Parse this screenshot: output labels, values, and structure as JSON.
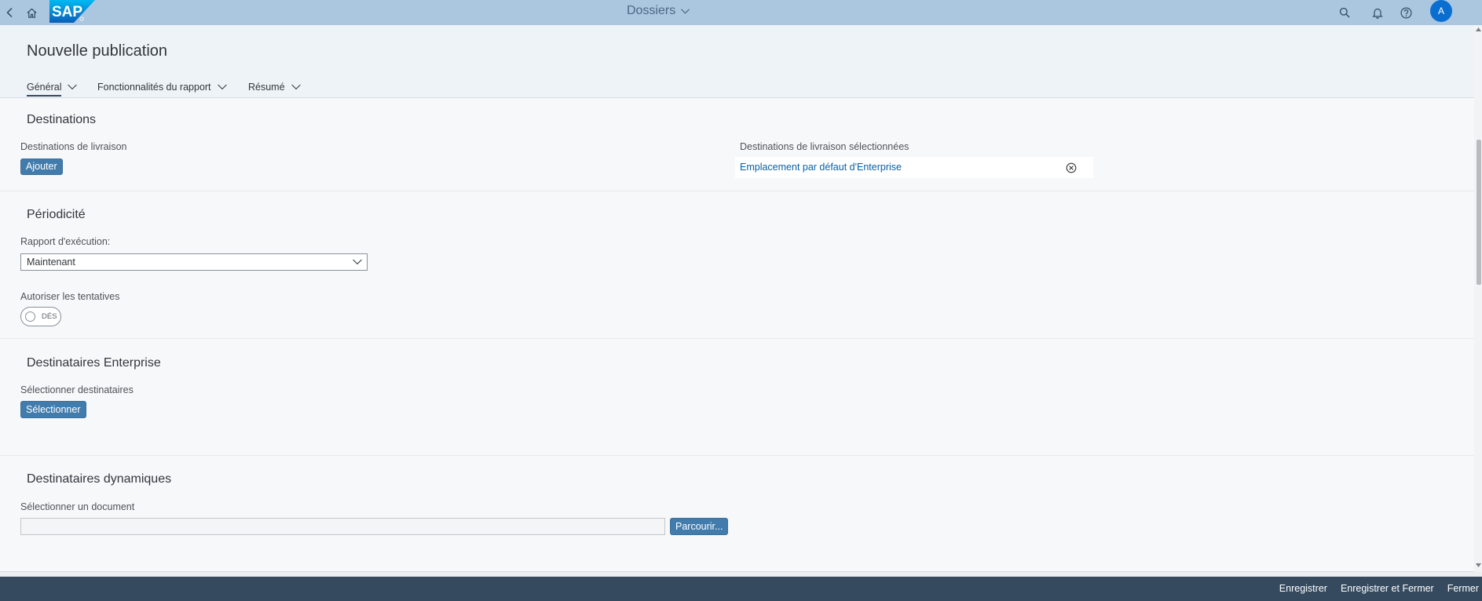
{
  "shell": {
    "title": "Dossiers",
    "logo_text": "SAP",
    "avatar_initial": "A",
    "icons": {
      "back": "back-icon",
      "home": "home-icon",
      "title_menu": "chevron-down-icon",
      "search": "search-icon",
      "notifications": "bell-icon",
      "help": "help-icon"
    }
  },
  "page": {
    "title": "Nouvelle publication",
    "tabs": [
      {
        "label": "Général",
        "selected": true
      },
      {
        "label": "Fonctionnalités du rapport",
        "selected": false
      },
      {
        "label": "Résumé",
        "selected": false
      }
    ]
  },
  "sections": {
    "destinations": {
      "heading": "Destinations",
      "delivery_label": "Destinations de livraison",
      "add_button": "Ajouter",
      "selected_label": "Destinations de livraison sélectionnées",
      "selected_items": [
        "Emplacement par défaut d'Enterprise"
      ]
    },
    "periodicity": {
      "heading": "Périodicité",
      "run_label": "Rapport d'exécution:",
      "run_value": "Maintenant",
      "retries_label": "Autoriser les tentatives",
      "retries_switch_text": "DÉS",
      "retries_on": false
    },
    "enterprise": {
      "heading": "Destinataires Enterprise",
      "select_label": "Sélectionner destinataires",
      "select_button": "Sélectionner"
    },
    "dynamic": {
      "heading": "Destinataires dynamiques",
      "document_label": "Sélectionner un document",
      "browse_button": "Parcourir..."
    }
  },
  "footer": {
    "save": "Enregistrer",
    "save_close": "Enregistrer et Fermer",
    "close": "Fermer"
  },
  "colors": {
    "shell_bg": "#abc6df",
    "accent": "#427cac",
    "link": "#0a5fa6",
    "footer_bg": "#354a5f",
    "avatar_bg": "#0a6ed1"
  }
}
